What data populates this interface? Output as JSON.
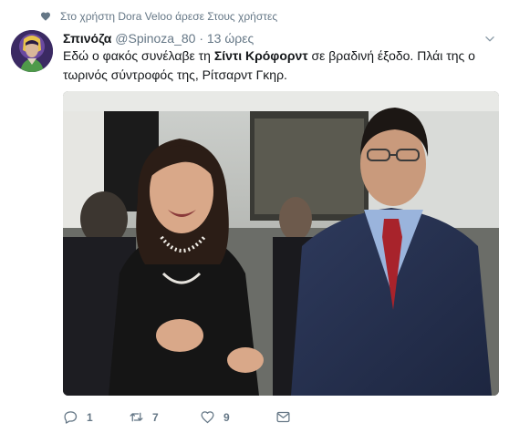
{
  "context": {
    "text": "Στο χρήστη Dora Veloo άρεσε Στους χρήστες"
  },
  "tweet": {
    "display_name": "Σπινόζα",
    "handle": "@Spinoza_80",
    "separator": "·",
    "time": "13 ώρες",
    "text_part1": "Εδώ ο φακός συνέλαβε τη ",
    "text_bold": "Σίντι Κρόφορντ",
    "text_part2": " σε βραδινή έξοδο. Πλάι της ο τωρινός σύντροφός της, Ρίτσαρντ Γκηρ."
  },
  "actions": {
    "reply_count": "1",
    "retweet_count": "7",
    "like_count": "9"
  },
  "icons": {
    "context": "heart-icon",
    "menu": "chevron-down-icon",
    "reply": "reply-icon",
    "retweet": "retweet-icon",
    "like": "heart-icon",
    "dm": "envelope-icon"
  },
  "colors": {
    "secondary_text": "#657786",
    "primary_text": "#14171a",
    "avatar_bg": "#3b2a63"
  }
}
